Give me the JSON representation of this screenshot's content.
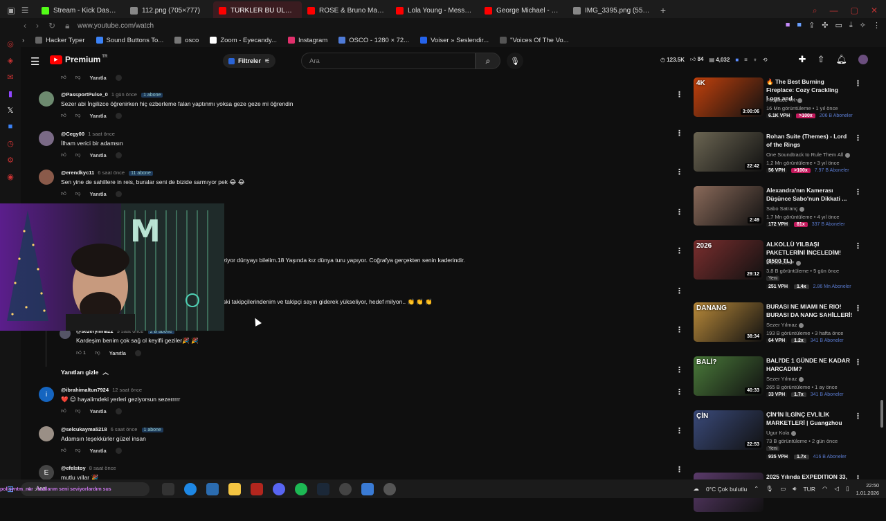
{
  "browser": {
    "tabs": [
      {
        "title": "Stream - Kick Dashboard",
        "favicon_color": "#53fc18",
        "active": false
      },
      {
        "title": "112.png (705×777)",
        "favicon_color": "#888888",
        "active": false
      },
      {
        "title": "TÜRKLER BU ÜLKEYE MU",
        "favicon_color": "#ff0000",
        "active": true
      },
      {
        "title": "ROSÉ & Bruno Mars - APT",
        "favicon_color": "#ff0000",
        "active": false
      },
      {
        "title": "Lola Young - Messy (NOV",
        "favicon_color": "#ff0000",
        "active": false
      },
      {
        "title": "George Michael - Careles",
        "favicon_color": "#ff0000",
        "active": false
      },
      {
        "title": "IMG_3395.png (551×508)",
        "favicon_color": "#888888",
        "active": false
      }
    ],
    "new_tab": "+",
    "url": "www.youtube.com/watch",
    "bookmarks": [
      {
        "label": "Hacker Typer",
        "color": "#666666"
      },
      {
        "label": "Sound Buttons To...",
        "color": "#3b82f6"
      },
      {
        "label": "osco",
        "color": "#777777"
      },
      {
        "label": "Zoom - Eyecandy...",
        "color": "#ffffff"
      },
      {
        "label": "Instagram",
        "color": "#e1306c"
      },
      {
        "label": "OSCO - 1280 × 72...",
        "color": "#4f7bd8"
      },
      {
        "label": "Voiser » Seslendir...",
        "color": "#2563eb"
      },
      {
        "label": "\"Voices Of The Vo...",
        "color": "#555555"
      }
    ]
  },
  "youtube": {
    "logo_text": "Premium",
    "region": "TR",
    "filters_label": "Filtreler",
    "search_placeholder": "Ara",
    "stats": {
      "views": "123.5K",
      "likes": "84",
      "comments": "4,032"
    }
  },
  "comments": {
    "reply_label": "Yanıtla",
    "top_actions_like_count": "",
    "items": [
      {
        "handle": "@PassportPulse_0",
        "time": "1 gün önce",
        "subs": "1 abone",
        "text": "Sezer abi İngilizce öğrenirken hiç ezberleme falan yaptınmı yoksa geze geze mi öğrendin",
        "avatar_color": "#6d8a6f"
      },
      {
        "handle": "@Cegy00",
        "time": "1 saat önce",
        "subs": "",
        "text": "İlham verici bir adamsın",
        "avatar_color": "#7a6a86"
      },
      {
        "handle": "@erendkyc11",
        "time": "6 saat önce",
        "subs": "11 abone",
        "text": "Sen yine de sahillere in reis, buralar seni de bizide sarmıyor pek 😂 😂",
        "avatar_color": "#8a5a4a"
      }
    ],
    "fragment_1": "ziyor dünyayı bilelim.18 Yaşında kız dünya turu yapıyor. Coğrafya gerçekten senin kaderindir.",
    "fragment_2": "ski takipçilerindenim ve takipçi sayın giderek yükseliyor, hedef milyon.. 👏 👏 👏",
    "nested_reply": {
      "handle": "@sezeryilmaz2",
      "time": "3 saat önce",
      "subs": "2 B abone",
      "text": "Kardeşim benim çok sağ ol keyifli geziler🎉 🎉",
      "likes": "1"
    },
    "hide_replies_label": "Yanıtları gizle",
    "items_2": [
      {
        "handle": "@ibrahimaltun7924",
        "time": "12 saat önce",
        "subs": "",
        "text": "❤️ 😊 hayalimdeki yerleri geziyorsun sezerrrrr",
        "avatar_color": "#1565c0",
        "avatar_letter": "i"
      },
      {
        "handle": "@selcukayma5218",
        "time": "6 saat önce",
        "subs": "1 abone",
        "text": "Adamsın teşekkürler güzel insan",
        "avatar_color": "#9a8f86",
        "avatar_letter": ""
      },
      {
        "handle": "@efelstoy",
        "time": "8 saat önce",
        "subs": "",
        "text": "mutlu yıllar 🎉",
        "avatar_color": "#444444",
        "avatar_letter": "E"
      }
    ]
  },
  "recommendations": [
    {
      "title": "🔥 The Best Burning Fireplace: Cozy Crackling Logs and ...",
      "channel": "Fireplace 4K",
      "views": "16 Mn görüntüleme • 1 yıl önce",
      "duration": "3:00:06",
      "vph": "6.1K VPH",
      "mult": ">100x",
      "mult_color": "#c2185b",
      "subs": "206 B Aboneler",
      "new": "",
      "thumb_color": "#c2410c",
      "thumb_corner": "4K"
    },
    {
      "title": "Rohan Suite (Themes) - Lord of the Rings",
      "channel": "One Soundtrack to Rule Them All",
      "views": "1,2 Mn görüntüleme • 3 yıl önce",
      "duration": "22:42",
      "vph": "56 VPH",
      "mult": ">100x",
      "mult_color": "#c2185b",
      "subs": "7.97 B Aboneler",
      "new": "",
      "thumb_color": "#6b6552",
      "thumb_corner": ""
    },
    {
      "title": "Alexandra'nın Kamerası Düşünce Sabo'nun Dikkati ...",
      "channel": "Sabo Satranç",
      "views": "1,7 Mn görüntüleme • 4 yıl önce",
      "duration": "2:49",
      "vph": "172 VPH",
      "mult": "81x",
      "mult_color": "#c2185b",
      "subs": "337 B Aboneler",
      "new": "",
      "thumb_color": "#8a6a5a",
      "thumb_corner": ""
    },
    {
      "title": "ALKOLLÜ YILBAŞI PAKETLERİNİ İNCELEDİM! (8500 TL)",
      "channel": "MuratAbiGF",
      "views": "3,8 B görüntüleme • 5 gün önce",
      "duration": "29:12",
      "vph": "251 VPH",
      "mult": "1.4x",
      "mult_color": "#333333",
      "subs": "2.86 Mn Aboneler",
      "new": "Yeni",
      "thumb_color": "#7a2e2e",
      "thumb_corner": "2026"
    },
    {
      "title": "BURASI NE MIAMI NE RIO! BURASI DA NANG SAHİLLERİ!",
      "channel": "Sezer Yılmaz",
      "views": "193 B görüntüleme • 3 hafta önce",
      "duration": "38:34",
      "vph": "64 VPH",
      "mult": "1.2x",
      "mult_color": "#333333",
      "subs": "341 B Aboneler",
      "new": "",
      "thumb_color": "#b98a3a",
      "thumb_corner": "DANANG"
    },
    {
      "title": "BALİ'DE 1 GÜNDE NE KADAR HARCADIM?",
      "channel": "Sezer Yılmaz",
      "views": "265 B görüntüleme • 1 ay önce",
      "duration": "40:33",
      "vph": "33 VPH",
      "mult": "1.7x",
      "mult_color": "#333333",
      "subs": "341 B Aboneler",
      "new": "",
      "thumb_color": "#4a7a3a",
      "thumb_corner": "BALİ?"
    },
    {
      "title": "ÇİN'İN İLGİNÇ EVLİLİK MARKETLERİ | Guangzhou",
      "channel": "Ugur Kola",
      "views": "73 B görüntüleme • 2 gün önce",
      "duration": "22:53",
      "vph": "935 VPH",
      "mult": "1.7x",
      "mult_color": "#333333",
      "subs": "416 B Aboneler",
      "new": "Yeni",
      "thumb_color": "#3a4a7a",
      "thumb_corner": "ÇİN"
    },
    {
      "title": "2025 Yılında EXPEDITION 33,",
      "channel": "",
      "views": "",
      "duration": "",
      "vph": "",
      "mult": "",
      "mult_color": "#333333",
      "subs": "",
      "new": "",
      "thumb_color": "#5a3a6a",
      "thumb_corner": ""
    }
  ],
  "taskbar": {
    "search_label": "Ara",
    "weather": "0°C  Çok bulutlu",
    "lang": "TUR",
    "time": "22:50",
    "date": "1.01.2026",
    "ticker": "polisyntm_nar : badlarım seni seviyorlardım sus"
  }
}
